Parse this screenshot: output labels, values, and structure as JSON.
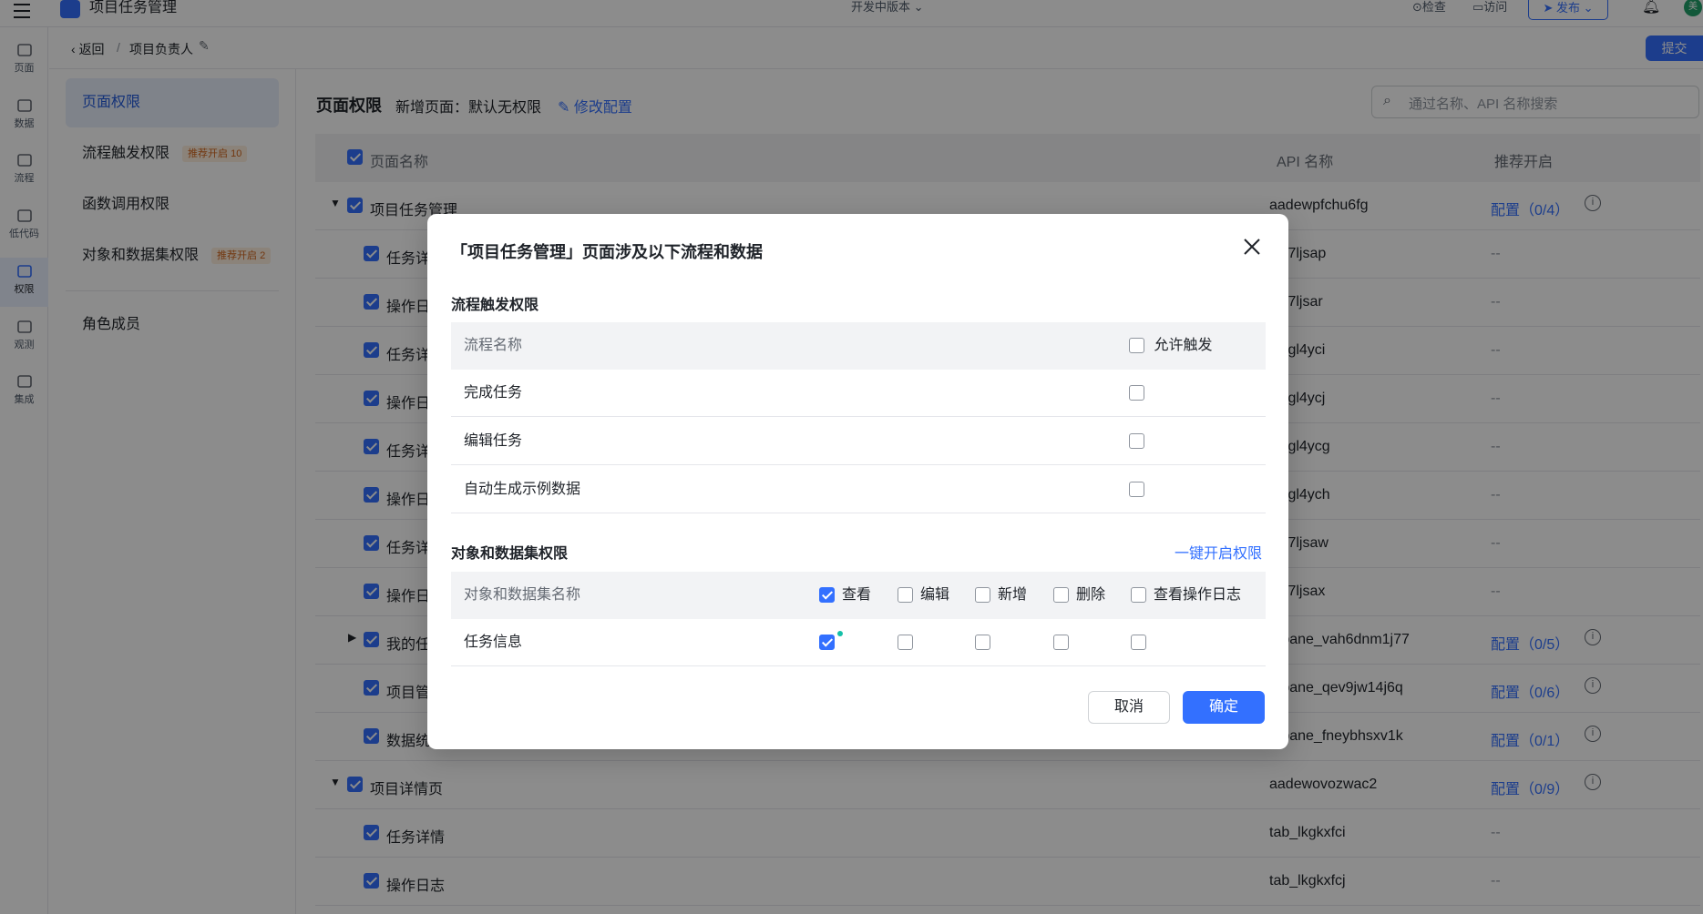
{
  "app": {
    "title": "项目任务管理",
    "version": "开发中版本",
    "check": "检查",
    "visit": "访问",
    "publish": "发布",
    "avatar": "美",
    "submit": "提交"
  },
  "rail": [
    {
      "label": "页面",
      "icon": "layout-icon"
    },
    {
      "label": "数据",
      "icon": "database-icon"
    },
    {
      "label": "流程",
      "icon": "flow-icon"
    },
    {
      "label": "低代码",
      "icon": "code-icon"
    },
    {
      "label": "权限",
      "icon": "lock-icon"
    },
    {
      "label": "观测",
      "icon": "monitor-icon"
    },
    {
      "label": "集成",
      "icon": "cube-icon"
    }
  ],
  "breadcrumb": {
    "back": "返回",
    "sep": "/",
    "current": "项目负责人"
  },
  "nav": {
    "items": [
      {
        "label": "页面权限"
      },
      {
        "label": "流程触发权限",
        "badge": "推荐开启 10"
      },
      {
        "label": "函数调用权限"
      },
      {
        "label": "对象和数据集权限",
        "badge": "推荐开启 2"
      },
      {
        "label": "角色成员"
      }
    ]
  },
  "main": {
    "title": "页面权限",
    "new_page": "新增页面：默认无权限",
    "modify": "修改配置",
    "search_placeholder": "通过名称、API 名称搜索",
    "columns": {
      "name": "页面名称",
      "api": "API 名称",
      "recommend": "推荐开启"
    },
    "rows": [
      {
        "name": "项目任务管理",
        "api": "aadewpfchu6fg",
        "rec": "配置（0/4）",
        "level": 0,
        "expanded": true
      },
      {
        "name": "任务详",
        "api": "_lk7ljsap",
        "rec": "--",
        "level": 1
      },
      {
        "name": "操作日",
        "api": "_lk7ljsar",
        "rec": "--",
        "level": 1
      },
      {
        "name": "任务详",
        "api": "_lkgl4yci",
        "rec": "--",
        "level": 1
      },
      {
        "name": "操作日",
        "api": "_lkgl4ycj",
        "rec": "--",
        "level": 1
      },
      {
        "name": "任务详",
        "api": "_lkgl4ycg",
        "rec": "--",
        "level": 1
      },
      {
        "name": "操作日",
        "api": "_lkgl4ych",
        "rec": "--",
        "level": 1
      },
      {
        "name": "任务详",
        "api": "_lk7ljsaw",
        "rec": "--",
        "level": 1
      },
      {
        "name": "操作日",
        "api": "_lk7ljsax",
        "rec": "--",
        "level": 1
      },
      {
        "name": "我的任",
        "api": "/_pane_vah6dnm1j77",
        "rec": "配置（0/5）",
        "level": 1,
        "collapsed": true
      },
      {
        "name": "项目管",
        "api": "/_pane_qev9jw14j6q",
        "rec": "配置（0/6）",
        "level": 1
      },
      {
        "name": "数据统",
        "api": "/_pane_fneybhsxv1k",
        "rec": "配置（0/1）",
        "level": 1
      },
      {
        "name": "项目详情页",
        "api": "aadewovozwac2",
        "rec": "配置（0/9）",
        "level": 0,
        "expanded": true
      },
      {
        "name": "任务详情",
        "api": "tab_lkgkxfci",
        "rec": "--",
        "level": 1
      },
      {
        "name": "操作日志",
        "api": "tab_lkgkxfcj",
        "rec": "--",
        "level": 1
      }
    ]
  },
  "modal": {
    "title": "「项目任务管理」页面涉及以下流程和数据",
    "flow_section": "流程触发权限",
    "flow_head": {
      "name": "流程名称",
      "allow": "允许触发"
    },
    "flows": [
      "完成任务",
      "编辑任务",
      "自动生成示例数据"
    ],
    "obj_section": "对象和数据集权限",
    "enable_all": "一键开启权限",
    "obj_head": {
      "name": "对象和数据集名称",
      "view": "查看",
      "edit": "编辑",
      "add": "新增",
      "delete": "删除",
      "log": "查看操作日志"
    },
    "objects": [
      {
        "name": "任务信息",
        "view": true,
        "edit": false,
        "add": false,
        "delete": false,
        "log": false
      }
    ],
    "cancel": "取消",
    "ok": "确定"
  }
}
